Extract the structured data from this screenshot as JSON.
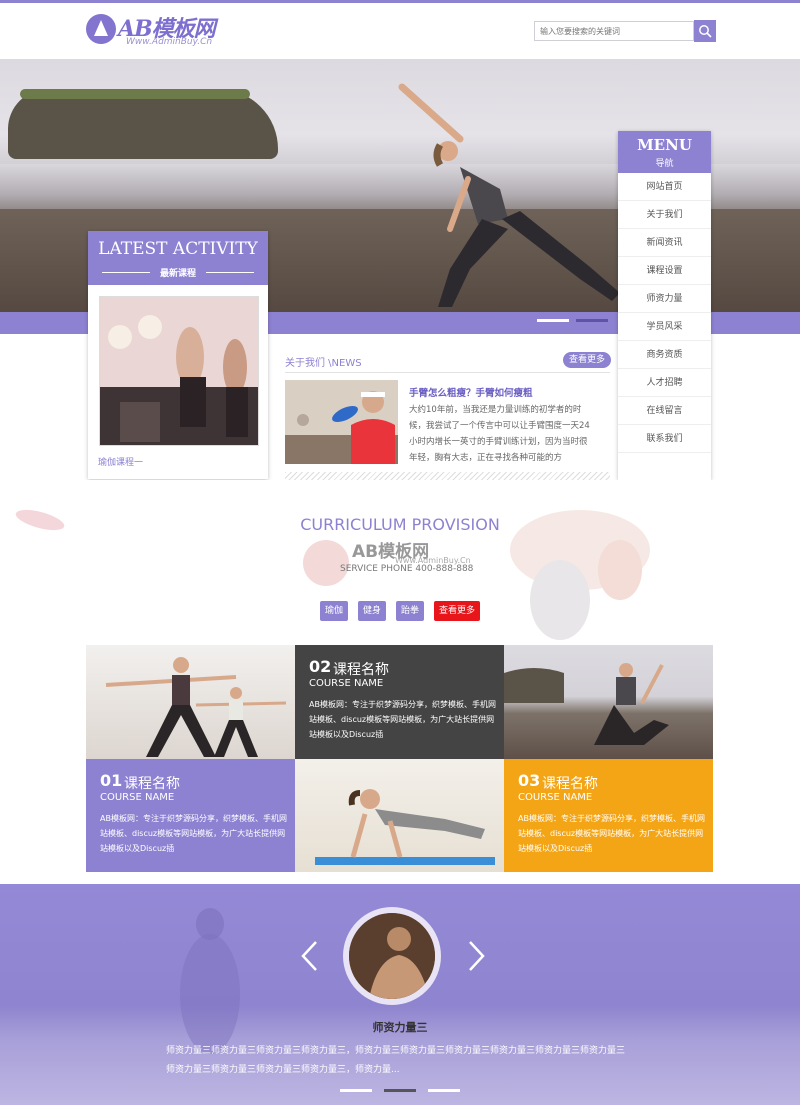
{
  "brand": {
    "logo_text": "AB模板网",
    "logo_sub": "Www.AdminBuy.Cn"
  },
  "search": {
    "placeholder": "输入您要搜索的关键词"
  },
  "hero": {
    "slides": 2
  },
  "activity": {
    "title": "LATEST ACTIVITY",
    "subtitle": "最新课程",
    "caption": "瑜伽课程一"
  },
  "news": {
    "label": "关于我们 \\NEWS",
    "more": "查看更多",
    "title": "手臂怎么粗瘦？手臂如何瘦粗",
    "body": "大约10年前，当我还是力量训练的初学者的时候，我尝试了一个传言中可以让手臂围度一天24小时内增长一英寸的手臂训练计划，因为当时很年轻，胸有大志，正在寻找各种可能的方"
  },
  "menu": {
    "title": "MENU",
    "subtitle": "导航",
    "items": [
      "网站首页",
      "关于我们",
      "新闻资讯",
      "课程设置",
      "师资力量",
      "学员风采",
      "商务资质",
      "人才招聘",
      "在线留言",
      "联系我们"
    ]
  },
  "curriculum": {
    "title": "CURRICULUM PROVISION",
    "watermark": "AB模板网",
    "watermark_sub": "Www.AdminBuy.Cn",
    "service_phone": "SERVICE PHONE 400-888-888",
    "buttons": [
      "瑜伽",
      "健身",
      "跆拳",
      "查看更多"
    ]
  },
  "courses": [
    {
      "num": "01",
      "name": "课程名称",
      "en": "COURSE NAME",
      "text": "AB模板网：专注于织梦源码分享，织梦模板、手机网站模板、discuz模板等网站模板，为广大站长提供网站模板以及Discuz插"
    },
    {
      "num": "02",
      "name": "课程名称",
      "en": "COURSE NAME",
      "text": "AB模板网：专注于织梦源码分享，织梦模板、手机网站模板、discuz模板等网站模板，为广大站长提供网站模板以及Discuz插"
    },
    {
      "num": "03",
      "name": "课程名称",
      "en": "COURSE NAME",
      "text": "AB模板网：专注于织梦源码分享，织梦模板、手机网站模板、discuz模板等网站模板，为广大站长提供网站模板以及Discuz插"
    }
  ],
  "teacher": {
    "name": "师资力量三",
    "desc": "师资力量三师资力量三师资力量三师资力量三，师资力量三师资力量三师资力量三师资力量三师资力量三师资力量三师资力量三师资力量三师资力量三师资力量三，师资力量..."
  },
  "colors": {
    "accent": "#8d82d2",
    "orange": "#f4a516",
    "dark": "#444444",
    "red": "#e8151b"
  }
}
